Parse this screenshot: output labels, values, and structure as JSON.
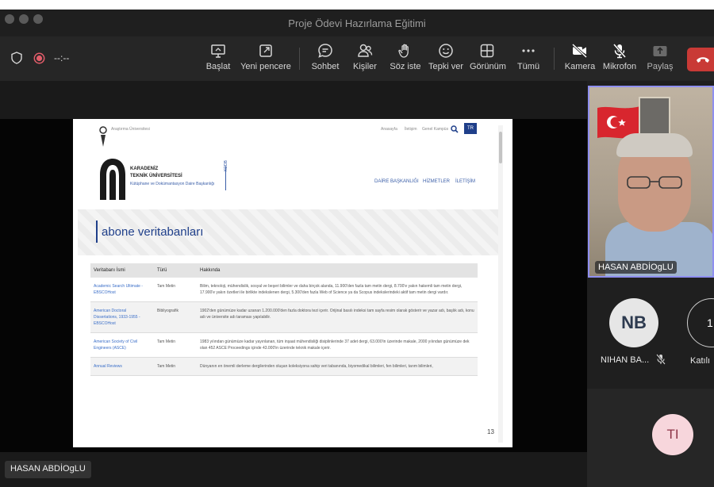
{
  "window": {
    "title": "Proje Ödevi Hazırlama Eğitimi"
  },
  "toolbar": {
    "timer": "--:--",
    "buttons": [
      {
        "label": "Başlat",
        "icon": "share-screen-icon"
      },
      {
        "label": "Yeni pencere",
        "icon": "new-window-icon"
      },
      {
        "label": "Sohbet",
        "icon": "chat-icon"
      },
      {
        "label": "Kişiler",
        "icon": "people-icon"
      },
      {
        "label": "Söz iste",
        "icon": "raise-hand-icon"
      },
      {
        "label": "Tepki ver",
        "icon": "reaction-icon"
      },
      {
        "label": "Görünüm",
        "icon": "view-icon"
      },
      {
        "label": "Tümü",
        "icon": "more-icon"
      },
      {
        "label": "Kamera",
        "icon": "camera-off-icon"
      },
      {
        "label": "Mikrofon",
        "icon": "mic-off-icon"
      },
      {
        "label": "Paylaş",
        "icon": "share-icon"
      }
    ]
  },
  "shared_page": {
    "top_links": [
      "Araştırma Üniversitesi",
      "Anasayfa",
      "İletişim",
      "Genel Kampüs"
    ],
    "lang": "TR",
    "logo_line1": "KARADENİZ",
    "logo_line2": "TEKNİK ÜNİVERSİTESİ",
    "logo_line3": "Kütüphane ve Dokümantasyon Daire Başkanlığı",
    "logo_abbr": "KDDB",
    "nav": [
      "DAİRE BAŞKANLIĞI",
      "HİZMETLER",
      "İLETİŞİM"
    ],
    "heading": "abone veritabanları",
    "table": {
      "headers": [
        "Veritabanı İsmi",
        "Türü",
        "Hakkında"
      ],
      "rows": [
        {
          "name": "Academic Search Ultimate - EBSCOHost",
          "type": "Tam Metin",
          "about": "Bilim, teknoloji, mühendislik, sosyal ve beşeri bilimler ve daha birçok alanda, 11.900'den fazla tam metin dergi, 8.700'e yakın hakemli tam metin dergi, 17.900'e yakın özetleri ile birlikte indekslenen dergi, 5.300'den fazla Web of Science ya da Scopus indekslerindeki aktif tam metin dergi vardır."
        },
        {
          "name": "American Doctoral Dissertations, 1933-1955 - EBSCOHost",
          "type": "Bibliyografik",
          "about": "1902'den günümüze kadar uzanan 1.200.000'den fazla doktora tezi içerir. Orijinal basılı indeksi tam sayfa resim olarak gösterir ve yazar adı, başlık adı, konu adı ve üniversite adı taraması yapılabilir."
        },
        {
          "name": "American Society of Civil Engineers (ASCE)",
          "type": "Tam Metin",
          "about": "1983 yılından günümüze kadar yayınlanan, tüm inşaat mühendisliği disiplinlerinde 37 adet dergi, 63.000'in üzerinde makale, 2000 yılından günümüze dek olan 452 ASCE Proceedings içinde 43.000'in üzerinde teknik makale içerir."
        },
        {
          "name": "Annual Reviews",
          "type": "Tam Metin",
          "about": "Dünyanın en önemli derleme dergilerinden oluşan koleksiyona sahip veri tabanında, biyomedikal bilimleri, fen bilimleri, tarım bilimleri,"
        }
      ]
    },
    "page_num": "13"
  },
  "stage": {
    "presenter_name": "HASAN ABDİOgLU"
  },
  "participants": {
    "video_name": "HASAN ABDİOgLU",
    "nb": {
      "initials": "NB",
      "name": "NIHAN BA...",
      "bg": "#e6e6e6",
      "color": "#2d3a4f"
    },
    "partial": {
      "initials": "1",
      "name": "Katılı"
    },
    "ti": {
      "initials": "TI",
      "bg": "#f7d6dc",
      "color": "#8d3447"
    }
  },
  "colors": {
    "accent": "#8f8ff0",
    "leave": "#c93a36",
    "record": "#e35d6a"
  }
}
